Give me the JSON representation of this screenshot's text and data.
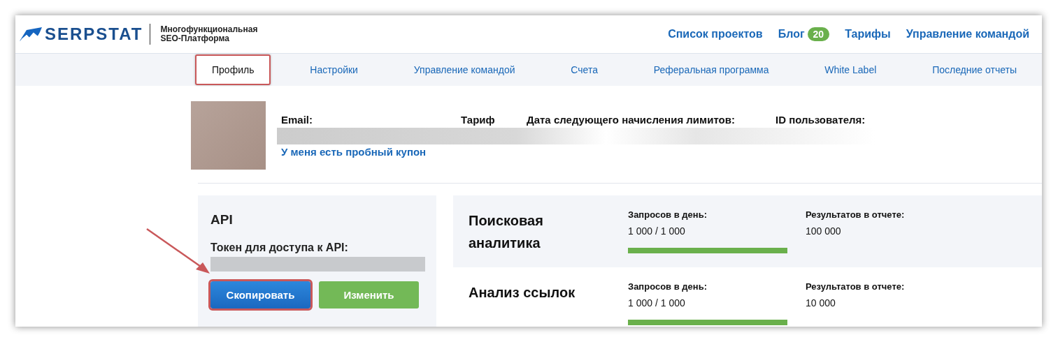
{
  "header": {
    "logo": "SERPSTAT",
    "tagline_1": "Многофункциональная",
    "tagline_2": "SEO-Платформа",
    "nav": [
      {
        "label": "Список проектов"
      },
      {
        "label": "Блог",
        "badge": "20"
      },
      {
        "label": "Тарифы"
      },
      {
        "label": "Управление командой"
      }
    ]
  },
  "tabs": [
    {
      "label": "Профиль",
      "selected": true,
      "highlighted": true
    },
    {
      "label": "Настройки",
      "selected": false,
      "highlighted": false
    },
    {
      "label": "Управление командой",
      "selected": false,
      "highlighted": false
    },
    {
      "label": "Счета",
      "selected": false,
      "highlighted": false
    },
    {
      "label": "Реферальная программа",
      "selected": false,
      "highlighted": false
    },
    {
      "label": "White Label",
      "selected": false,
      "highlighted": false
    },
    {
      "label": "Последние отчеты",
      "selected": false,
      "highlighted": false
    }
  ],
  "profile": {
    "fields": [
      "Email:",
      "Тариф",
      "Дата следующего начисления лимитов:",
      "ID пользователя:"
    ],
    "coupon_link": "У меня есть пробный купон"
  },
  "api": {
    "title": "API",
    "token_label": "Токен для доступа к API:",
    "buttons": [
      {
        "label": "Скопировать",
        "kind": "primary",
        "highlighted": true
      },
      {
        "label": "Изменить",
        "kind": "success",
        "highlighted": false
      }
    ]
  },
  "limits": [
    {
      "name": "Поисковая аналитика",
      "requests_label": "Запросов в день:",
      "requests": "1 000 / 1 000",
      "level": 1,
      "results_label": "Результатов в отчете:",
      "results": "100 000"
    },
    {
      "name": "Анализ ссылок",
      "requests_label": "Запросов в день:",
      "requests": "1 000 / 1 000",
      "level": 1,
      "results_label": "Результатов в отчете:",
      "results": "10 000"
    }
  ]
}
